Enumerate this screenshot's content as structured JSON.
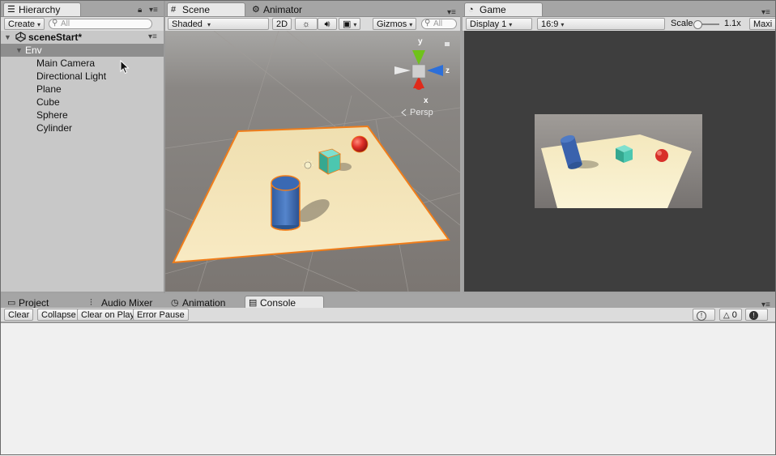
{
  "hierarchy": {
    "tab_label": "Hierarchy",
    "create_label": "Create",
    "search_placeholder": "All",
    "scene_name": "sceneStart*",
    "group": "Env",
    "items": [
      "Main Camera",
      "Directional Light",
      "Plane",
      "Cube",
      "Sphere",
      "Cylinder"
    ]
  },
  "scene": {
    "tab_label": "Scene",
    "animator_tab_label": "Animator",
    "shading_mode": "Shaded",
    "mode_2d": "2D",
    "gizmos_label": "Gizmos",
    "search_placeholder": "All",
    "axis_y": "y",
    "axis_z": "z",
    "axis_x": "x",
    "projection": "Persp"
  },
  "game": {
    "tab_label": "Game",
    "display": "Display 1",
    "aspect": "16:9",
    "scale_label": "Scale",
    "scale_value": "1.1x",
    "maximize_label": "Maxi"
  },
  "bottom": {
    "tabs": [
      {
        "label": "Project",
        "icon": "folder-icon"
      },
      {
        "label": "Audio Mixer",
        "icon": "mixer-icon"
      },
      {
        "label": "Animation",
        "icon": "clock-icon"
      },
      {
        "label": "Console",
        "icon": "console-icon"
      }
    ],
    "console": {
      "clear": "Clear",
      "collapse": "Collapse",
      "clear_on_play": "Clear on Play",
      "error_pause": "Error Pause",
      "info_count": "0",
      "warning_count": "0",
      "error_count": "0"
    }
  },
  "colors": {
    "selection_outline": "#f07d1a",
    "scene_bg": "#7d7875",
    "game_bg": "#3e3e3e",
    "plane": "#f3e4b6",
    "cylinder": "#3f6fb8",
    "cube": "#4cc7b0",
    "sphere": "#e2322a"
  }
}
